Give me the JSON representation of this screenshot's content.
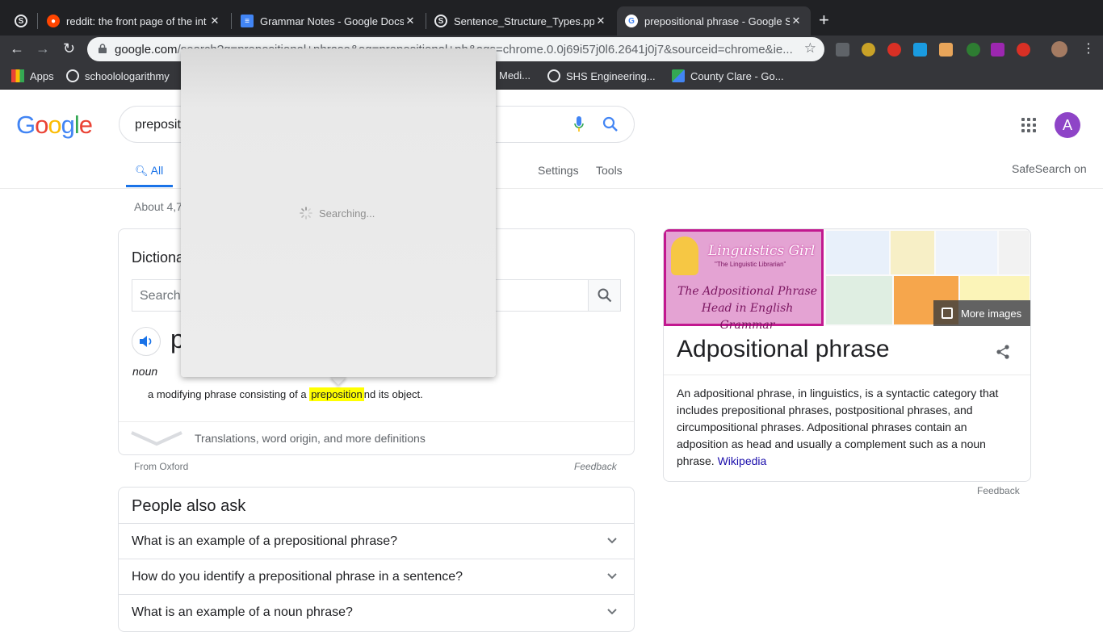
{
  "tabs": [
    {
      "title": "",
      "icon": "s-logo-icon",
      "close": ""
    },
    {
      "title": "reddit: the front page of the int",
      "icon": "reddit-icon",
      "close": "✕"
    },
    {
      "title": "Grammar Notes - Google Docs",
      "icon": "docs-icon",
      "close": "✕"
    },
    {
      "title": "Sentence_Structure_Types.ppt",
      "icon": "s-logo-icon",
      "close": "✕"
    },
    {
      "title": "prepositional phrase - Google S",
      "icon": "google-icon",
      "close": "✕",
      "active": true
    }
  ],
  "new_tab": "+",
  "omnibox": {
    "host": "google.com",
    "rest": "/search?q=prepositional+phrase&oq=prepositional+ph&aqs=chrome.0.0j69i57j0l6.2641j0j7&sourceid=chrome&ie..."
  },
  "bookmarks": [
    {
      "label": "Apps",
      "icon": "apps-icon"
    },
    {
      "label": "schoolologarithmy",
      "icon": "s-logo-icon"
    },
    {
      "label": "Medi...",
      "icon": ""
    },
    {
      "label": "SHS Engineering...",
      "icon": "s-logo-icon"
    },
    {
      "label": "County Clare - Go...",
      "icon": "maps-icon"
    }
  ],
  "google": {
    "logo": "Google",
    "query": "preposit",
    "avatar_letter": "A"
  },
  "nav_tabs": {
    "all": "All",
    "settings": "Settings",
    "tools": "Tools",
    "safesearch": "SafeSearch on"
  },
  "stats": "About 4,7",
  "dictionary": {
    "title": "Dictiona",
    "search_placeholder": "Search",
    "word": "p",
    "pos": "noun",
    "def_before": "a modifying phrase consisting of a",
    "def_highlight": "preposition",
    "def_after": "nd its object.",
    "more": "Translations, word origin, and more definitions",
    "source": "From Oxford",
    "feedback": "Feedback"
  },
  "people_also_ask": {
    "title": "People also ask",
    "questions": [
      "What is an example of a prepositional phrase?",
      "How do you identify a prepositional phrase in a sentence?",
      "What is an example of a noun phrase?"
    ]
  },
  "knowledge_panel": {
    "image_title": "Linguistics Girl",
    "image_subtitle": "\"The Linguistic Librarian\"",
    "image_caption": "The Adpositional Phrase Head in English Grammar",
    "more_images": "More images",
    "title": "Adpositional phrase",
    "description": "An adpositional phrase, in linguistics, is a syntactic category that includes prepositional phrases, postpositional phrases, and circumpositional phrases. Adpositional phrases contain an adposition as head and usually a complement such as a noun phrase.",
    "link": "Wikipedia",
    "feedback": "Feedback"
  },
  "popup": {
    "status": "Searching..."
  },
  "colors": {
    "accent": "#1a73e8",
    "highlight": "#ffff00",
    "avatar": "#8e44c7",
    "link": "#1a0dab"
  }
}
